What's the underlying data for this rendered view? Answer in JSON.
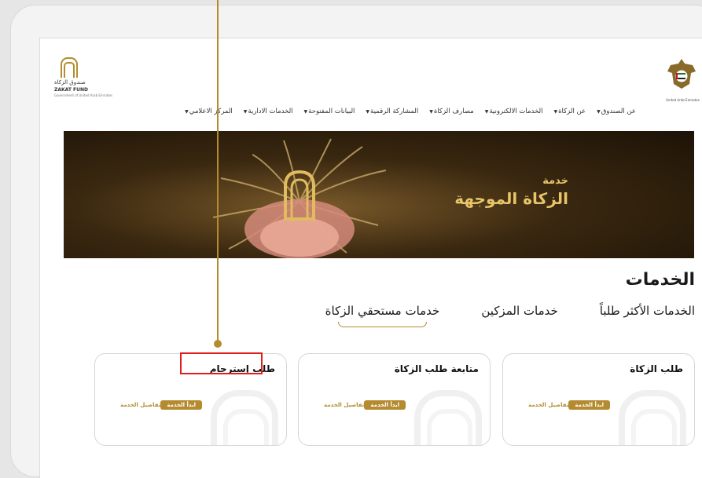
{
  "header": {
    "fund_logo": {
      "ar": "صندوق الزكاة",
      "en": "ZAKAT FUND",
      "sub": "Government of United Arab Emirates"
    },
    "emblem_label": "United Arab Emirates"
  },
  "nav": {
    "items": [
      {
        "label": "عن الصندوق",
        "dropdown": true
      },
      {
        "label": "عن الزكاة",
        "dropdown": true
      },
      {
        "label": "الخدمات الالكترونية",
        "dropdown": true
      },
      {
        "label": "مصارف الزكاة",
        "dropdown": true
      },
      {
        "label": "المشاركة الرقمية",
        "dropdown": true
      },
      {
        "label": "البيانات المفتوحة",
        "dropdown": true
      },
      {
        "label": "الخدمات الادارية",
        "dropdown": true
      },
      {
        "label": "المركز الاعلامي",
        "dropdown": true
      }
    ]
  },
  "banner": {
    "small": "خدمة",
    "big": "الزكاة الموجهة"
  },
  "services": {
    "title": "الخدمات",
    "tabs": [
      {
        "label": "الخدمات الأكثر طلباً",
        "active": false
      },
      {
        "label": "خدمات المزكين",
        "active": false
      },
      {
        "label": "خدمات مستحقي الزكاة",
        "active": true
      }
    ],
    "cards": [
      {
        "title": "طلب الزكاة",
        "details": "تفاصيل الخدمة",
        "start": "ابدأ الخدمة"
      },
      {
        "title": "متابعة طلب الزكاة",
        "details": "تفاصيل الخدمة",
        "start": "ابدأ الخدمة"
      },
      {
        "title": "طلب إسترحام",
        "details": "تفاصيل الخدمة",
        "start": "ابدأ الخدمة",
        "highlighted": true
      }
    ]
  },
  "colors": {
    "accent": "#b58b2f",
    "highlight": "#e01e1e"
  }
}
